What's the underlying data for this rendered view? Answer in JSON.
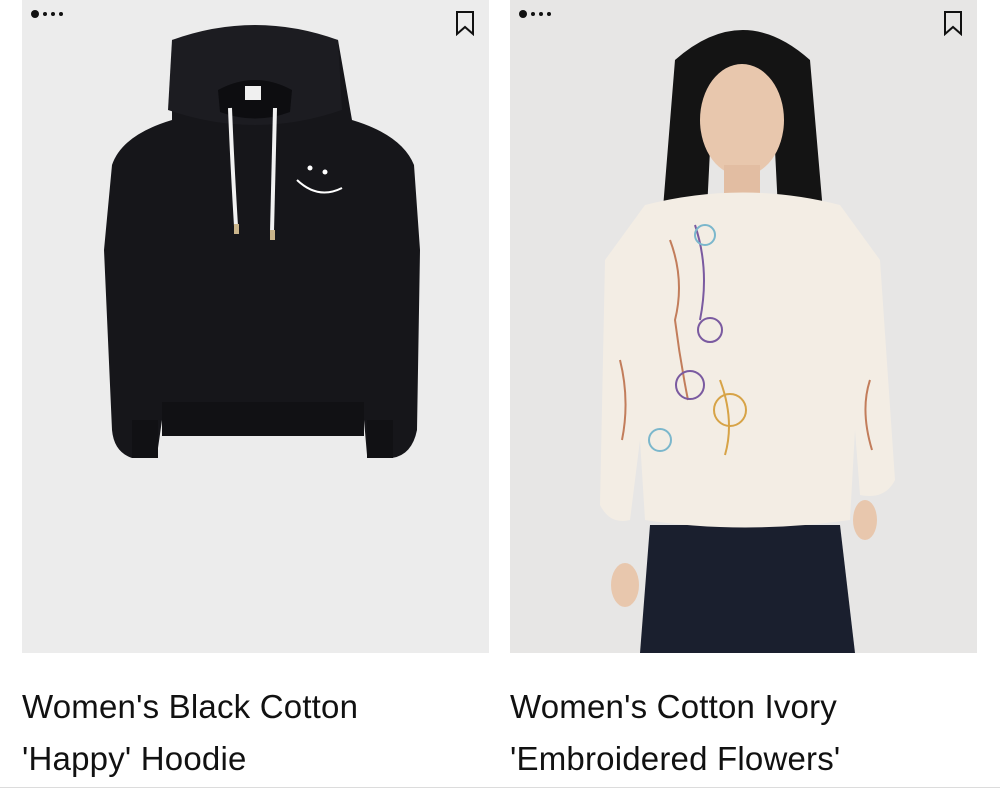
{
  "products": [
    {
      "title_line1": "Women's Black Cotton",
      "title_line2": "'Happy' Hoodie",
      "image": "black-hoodie-product-photo",
      "carousel_dots": 4,
      "carousel_active": 0,
      "colors": {
        "garment": "#16161a",
        "background": "#ececec"
      }
    },
    {
      "title_line1": "Women's Cotton Ivory",
      "title_line2": "'Embroidered Flowers'",
      "image": "model-wearing-ivory-embroidered-sweatshirt-photo",
      "carousel_dots": 4,
      "carousel_active": 0,
      "colors": {
        "garment": "#f3ede4",
        "background": "#e7e6e5"
      }
    }
  ],
  "icons": {
    "bookmark": "bookmark-outline-icon"
  }
}
